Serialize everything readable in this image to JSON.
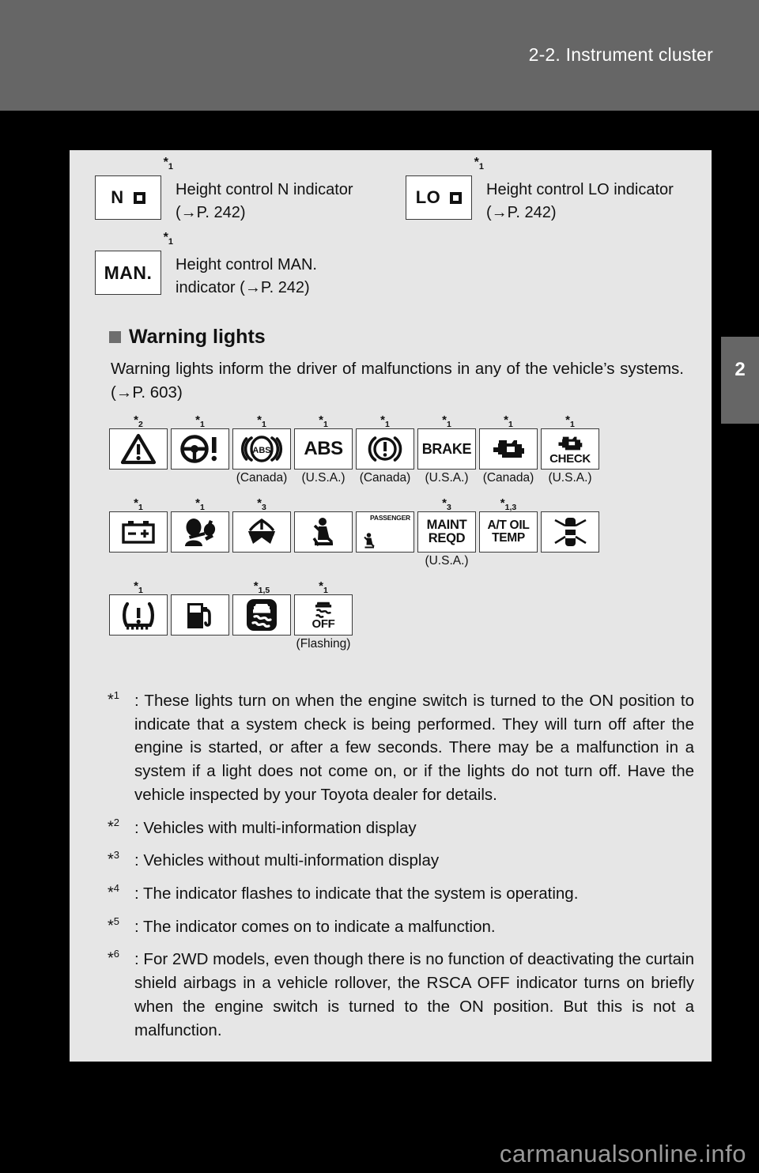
{
  "header": {
    "title": "2-2. Instrument cluster"
  },
  "chapter_tab": {
    "number": "2"
  },
  "indicators": [
    {
      "box_label": "N",
      "has_square": true,
      "star": "*",
      "star_num": "1",
      "text": "Height control N indicator (→P. 242)"
    },
    {
      "box_label": "LO",
      "has_square": true,
      "star": "*",
      "star_num": "1",
      "text": "Height control LO indicator (→P. 242)"
    },
    {
      "box_label": "MAN.",
      "has_square": false,
      "star": "*",
      "star_num": "1",
      "text": "Height control MAN. indicator (→P. 242)"
    }
  ],
  "section": {
    "heading": "Warning lights",
    "body": "Warning lights inform the driver of malfunctions in any of the vehicle’s systems. (→P. 603)"
  },
  "warning_rows": [
    {
      "cells": [
        {
          "icon": "master-warning-triangle-icon",
          "star": "*",
          "star_num": "2",
          "region": ""
        },
        {
          "icon": "power-steering-warning-icon",
          "star": "*",
          "star_num": "1",
          "region": ""
        },
        {
          "icon": "abs-circle-warning-icon",
          "star": "*",
          "star_num": "1",
          "region": "(Canada)",
          "text": "ABS"
        },
        {
          "icon": "abs-text-warning-icon",
          "star": "*",
          "star_num": "1",
          "region": "(U.S.A.)",
          "text": "ABS"
        },
        {
          "icon": "brake-circle-warning-icon",
          "star": "*",
          "star_num": "1",
          "region": "(Canada)"
        },
        {
          "icon": "brake-text-warning-icon",
          "star": "*",
          "star_num": "1",
          "region": "(U.S.A.)",
          "text": "BRAKE"
        },
        {
          "icon": "engine-malfunction-icon",
          "star": "*",
          "star_num": "1",
          "region": "(Canada)"
        },
        {
          "icon": "check-engine-icon",
          "star": "*",
          "star_num": "1",
          "region": "(U.S.A.)",
          "text": "CHECK"
        }
      ]
    },
    {
      "cells": [
        {
          "icon": "charging-system-battery-icon",
          "star": "*",
          "star_num": "1",
          "region": ""
        },
        {
          "icon": "srs-airbag-warning-icon",
          "star": "*",
          "star_num": "1",
          "region": ""
        },
        {
          "icon": "low-washer-fluid-icon",
          "star": "*",
          "star_num": "3",
          "region": ""
        },
        {
          "icon": "driver-seat-belt-reminder-icon",
          "star": "",
          "star_num": "",
          "region": ""
        },
        {
          "icon": "passenger-seat-belt-reminder-icon",
          "star": "",
          "star_num": "",
          "region": "",
          "text": "PASSENGER"
        },
        {
          "icon": "maint-reqd-icon",
          "star": "*",
          "star_num": "3",
          "region": "(U.S.A.)",
          "text": "MAINT REQD"
        },
        {
          "icon": "at-oil-temp-icon",
          "star": "*",
          "star_num": "1,3",
          "region": "",
          "text": "A/T OIL TEMP"
        },
        {
          "icon": "door-open-warning-icon",
          "star": "",
          "star_num": "",
          "region": ""
        }
      ]
    },
    {
      "cells": [
        {
          "icon": "tire-pressure-warning-icon",
          "star": "*",
          "star_num": "1",
          "region": ""
        },
        {
          "icon": "low-fuel-level-icon",
          "star": "",
          "star_num": "",
          "region": ""
        },
        {
          "icon": "vsc-skid-warning-icon",
          "star": "*",
          "star_num": "1,5",
          "region": ""
        },
        {
          "icon": "vsc-off-indicator-icon",
          "star": "*",
          "star_num": "1",
          "region": "(Flashing)",
          "text": "OFF"
        }
      ]
    }
  ],
  "footnotes": [
    {
      "marker": "*",
      "marker_num": "1",
      "text": ": These lights turn on when the engine switch is turned to the ON position to indicate that a system check is being performed. They will turn off after the engine is started, or after a few seconds. There may be a malfunction in a system if a light does not come on, or if the lights do not turn off. Have the vehicle inspected by your Toyota dealer for details."
    },
    {
      "marker": "*",
      "marker_num": "2",
      "text": ": Vehicles with multi-information display"
    },
    {
      "marker": "*",
      "marker_num": "3",
      "text": ": Vehicles without multi-information display"
    },
    {
      "marker": "*",
      "marker_num": "4",
      "text": ": The indicator flashes to indicate that the system is operating."
    },
    {
      "marker": "*",
      "marker_num": "5",
      "text": ": The indicator comes on to indicate a malfunction."
    },
    {
      "marker": "*",
      "marker_num": "6",
      "text": ": For 2WD models, even though there is no function of deactivating the curtain shield airbags in a vehicle rollover, the RSCA OFF indicator turns on briefly when the engine switch is turned to the ON position. But this is not a malfunction."
    }
  ],
  "watermark": "carmanualsonline.info",
  "colors": {
    "page_background": "#000000",
    "header_bar": "#666666",
    "content_panel": "#e6e6e6",
    "ink": "#111111"
  }
}
